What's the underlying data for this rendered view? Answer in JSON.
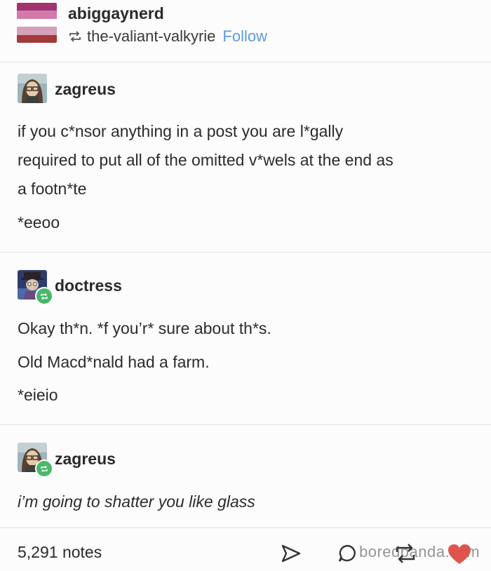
{
  "header": {
    "blog_name": "abiggaynerd",
    "reblogged_from": "the-valiant-valkyrie",
    "follow_label": "Follow",
    "flag_colors": [
      "#a1336e",
      "#d27bab",
      "#ffffff",
      "#d37a9b",
      "#a13a3a"
    ],
    "reblog_icon": "reblog-icon"
  },
  "reblogs": [
    {
      "username": "zagreus",
      "avatar_icon": "avatar-zagreus",
      "paragraphs": [
        "if you c*nsor anything in a post you are l*gally",
        "required to put all of the omitted v*wels at the end as",
        "a footn*te",
        "*eeoo"
      ]
    },
    {
      "username": "doctress",
      "avatar_icon": "avatar-doctress",
      "paragraphs": [
        "Okay th*n. *f you’r* sure about th*s.",
        "Old Macd*nald had a farm.",
        "*eieio"
      ]
    },
    {
      "username": "zagreus",
      "avatar_icon": "avatar-zagreus",
      "paragraphs": [
        "i’m going to shatter you like glass"
      ]
    }
  ],
  "footer": {
    "notes": "5,291 notes",
    "watermark": "boredpanda.com",
    "share_icon": "share-icon",
    "reply_icon": "reply-icon",
    "reblog_icon": "reblog-icon",
    "like_icon": "heart-icon",
    "like_color": "#e0544d",
    "badge_color": "#49b86a",
    "link_color": "#5d9be0"
  }
}
